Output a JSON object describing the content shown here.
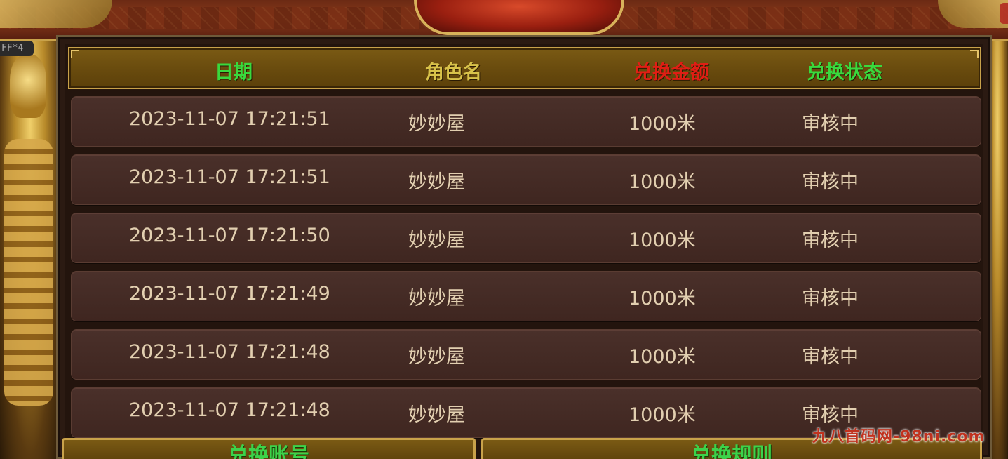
{
  "buff_label": "FF*4",
  "header": {
    "date": "日期",
    "role": "角色名",
    "amount": "兑换金额",
    "status": "兑换状态",
    "colors": {
      "date": "#39d93d",
      "role": "#d8c24a",
      "amount": "#e01e14",
      "status": "#39d93d"
    }
  },
  "rows": [
    {
      "date": "2023-11-07  17:21:51",
      "role": "妙妙屋",
      "amount": "1000米",
      "status": "审核中"
    },
    {
      "date": "2023-11-07  17:21:51",
      "role": "妙妙屋",
      "amount": "1000米",
      "status": "审核中"
    },
    {
      "date": "2023-11-07  17:21:50",
      "role": "妙妙屋",
      "amount": "1000米",
      "status": "审核中"
    },
    {
      "date": "2023-11-07  17:21:49",
      "role": "妙妙屋",
      "amount": "1000米",
      "status": "审核中"
    },
    {
      "date": "2023-11-07  17:21:48",
      "role": "妙妙屋",
      "amount": "1000米",
      "status": "审核中"
    },
    {
      "date": "2023-11-07  17:21:48",
      "role": "妙妙屋",
      "amount": "1000米",
      "status": "审核中"
    }
  ],
  "tabs": {
    "exchange_account": "兑换账号",
    "exchange_rules": "兑换规则"
  },
  "watermark": "九八首码网-98ni.com"
}
